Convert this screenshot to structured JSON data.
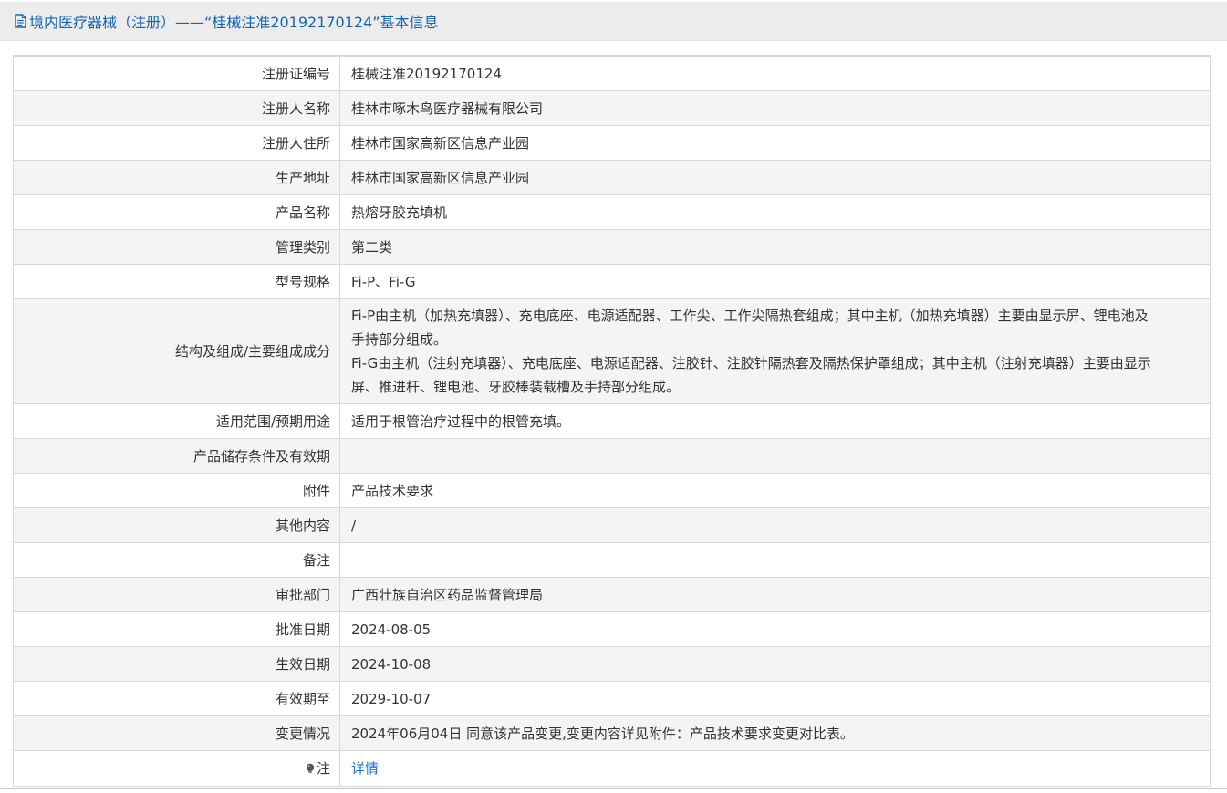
{
  "header": {
    "title": "境内医疗器械（注册）——“桂械注准20192170124”基本信息",
    "icon": "document-icon"
  },
  "rows": [
    {
      "label": "注册证编号",
      "value": "桂械注准20192170124"
    },
    {
      "label": "注册人名称",
      "value": "桂林市啄木鸟医疗器械有限公司"
    },
    {
      "label": "注册人住所",
      "value": "桂林市国家高新区信息产业园"
    },
    {
      "label": "生产地址",
      "value": "桂林市国家高新区信息产业园"
    },
    {
      "label": "产品名称",
      "value": "热熔牙胶充填机"
    },
    {
      "label": "管理类别",
      "value": "第二类"
    },
    {
      "label": "型号规格",
      "value": "Fi-P、Fi-G"
    },
    {
      "label": "结构及组成/主要组成成分",
      "value_lines": [
        "Fi-P由主机（加热充填器）、充电底座、电源适配器、工作尖、工作尖隔热套组成；其中主机（加热充填器）主要由显示屏、锂电池及",
        "手持部分组成。",
        "Fi-G由主机（注射充填器）、充电底座、电源适配器、注胶针、注胶针隔热套及隔热保护罩组成；其中主机（注射充填器）主要由显示",
        "屏、推进杆、锂电池、牙胶棒装载槽及手持部分组成。"
      ]
    },
    {
      "label": "适用范围/预期用途",
      "value": "适用于根管治疗过程中的根管充填。"
    },
    {
      "label": "产品储存条件及有效期",
      "value": ""
    },
    {
      "label": "附件",
      "value": "产品技术要求"
    },
    {
      "label": "其他内容",
      "value": "/"
    },
    {
      "label": "备注",
      "value": ""
    },
    {
      "label": "审批部门",
      "value": "广西壮族自治区药品监督管理局"
    },
    {
      "label": "批准日期",
      "value": "2024-08-05"
    },
    {
      "label": "生效日期",
      "value": "2024-10-08"
    },
    {
      "label": "有效期至",
      "value": "2029-10-07"
    },
    {
      "label": "变更情况",
      "value": "2024年06月04日 同意该产品变更,变更内容详见附件：产品技术要求变更对比表。"
    },
    {
      "label": "注",
      "value": "详情",
      "icon": "lightbulb-icon"
    }
  ],
  "colors": {
    "title": "#1464b4",
    "link": "#1a73c8",
    "border": "#d8d8d8",
    "row_alt": "#f4f4f4"
  }
}
